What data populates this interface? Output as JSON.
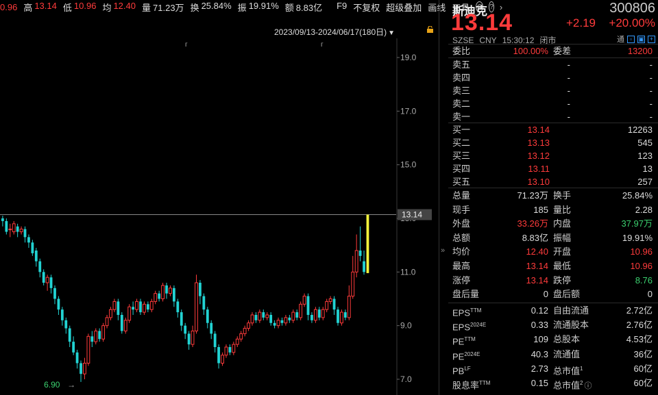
{
  "topbar": {
    "cut_value": "0.96",
    "items": [
      {
        "label": "高",
        "value": "13.14",
        "color": "red"
      },
      {
        "label": "低",
        "value": "10.96",
        "color": "red"
      },
      {
        "label": "均",
        "value": "12.40",
        "color": "red"
      },
      {
        "label": "量",
        "value": "71.23万",
        "color": "white"
      },
      {
        "label": "换",
        "value": "25.84%",
        "color": "white"
      },
      {
        "label": "振",
        "value": "19.91%",
        "color": "white"
      },
      {
        "label": "额",
        "value": "8.83亿",
        "color": "white"
      }
    ],
    "menu": [
      "F9",
      "不复权",
      "超级叠加",
      "画线",
      "工具"
    ],
    "icons": [
      "settings-icon",
      "help-icon",
      "chevron-right-icon"
    ],
    "range": "2023/09/13-2024/06/17(180日)"
  },
  "chart_data": {
    "type": "candlestick",
    "ylim": [
      7.0,
      19.0
    ],
    "yticks": [
      "19.0",
      "17.0",
      "15.0",
      "13.0",
      "11.0",
      "9.0",
      "7.0"
    ],
    "current_price_label": "13.14",
    "min_label": "6.90",
    "up_color": "#ff3b3b",
    "down_color": "#22d3d3",
    "last_color": "#f5f53b",
    "candles": [
      {
        "o": 13.0,
        "c": 12.9,
        "h": 13.1,
        "l": 12.7
      },
      {
        "o": 12.9,
        "c": 12.5,
        "h": 13.0,
        "l": 12.4
      },
      {
        "o": 12.6,
        "c": 12.6,
        "h": 12.8,
        "l": 12.3
      },
      {
        "o": 12.5,
        "c": 12.8,
        "h": 12.9,
        "l": 12.4
      },
      {
        "o": 12.7,
        "c": 12.5,
        "h": 12.8,
        "l": 12.3
      },
      {
        "o": 12.5,
        "c": 12.6,
        "h": 12.7,
        "l": 12.4
      },
      {
        "o": 12.6,
        "c": 12.3,
        "h": 12.7,
        "l": 12.1
      },
      {
        "o": 12.3,
        "c": 12.1,
        "h": 12.4,
        "l": 11.9
      },
      {
        "o": 12.1,
        "c": 11.7,
        "h": 12.2,
        "l": 11.6
      },
      {
        "o": 11.8,
        "c": 11.4,
        "h": 11.9,
        "l": 11.2
      },
      {
        "o": 11.4,
        "c": 11.0,
        "h": 11.5,
        "l": 10.8
      },
      {
        "o": 11.0,
        "c": 10.6,
        "h": 11.1,
        "l": 10.5
      },
      {
        "o": 10.6,
        "c": 10.8,
        "h": 10.9,
        "l": 10.3
      },
      {
        "o": 10.8,
        "c": 10.4,
        "h": 10.9,
        "l": 10.2
      },
      {
        "o": 10.4,
        "c": 10.0,
        "h": 10.5,
        "l": 9.8
      },
      {
        "o": 10.0,
        "c": 9.6,
        "h": 10.1,
        "l": 9.4
      },
      {
        "o": 9.6,
        "c": 9.2,
        "h": 9.7,
        "l": 9.0
      },
      {
        "o": 9.2,
        "c": 8.9,
        "h": 9.3,
        "l": 8.7
      },
      {
        "o": 8.9,
        "c": 8.4,
        "h": 9.0,
        "l": 8.2
      },
      {
        "o": 8.4,
        "c": 8.0,
        "h": 8.6,
        "l": 7.9
      },
      {
        "o": 8.0,
        "c": 7.6,
        "h": 8.1,
        "l": 7.4
      },
      {
        "o": 7.6,
        "c": 7.2,
        "h": 7.7,
        "l": 6.9
      },
      {
        "o": 7.2,
        "c": 7.6,
        "h": 7.8,
        "l": 7.0
      },
      {
        "o": 7.6,
        "c": 8.6,
        "h": 8.7,
        "l": 7.5
      },
      {
        "o": 8.6,
        "c": 8.4,
        "h": 8.8,
        "l": 8.2
      },
      {
        "o": 8.4,
        "c": 8.8,
        "h": 8.9,
        "l": 8.3
      },
      {
        "o": 8.8,
        "c": 8.5,
        "h": 8.9,
        "l": 8.4
      },
      {
        "o": 8.5,
        "c": 9.0,
        "h": 9.1,
        "l": 8.4
      },
      {
        "o": 9.0,
        "c": 9.3,
        "h": 9.4,
        "l": 8.9
      },
      {
        "o": 9.3,
        "c": 9.6,
        "h": 9.7,
        "l": 9.2
      },
      {
        "o": 9.6,
        "c": 9.9,
        "h": 10.0,
        "l": 9.5
      },
      {
        "o": 9.9,
        "c": 9.4,
        "h": 10.0,
        "l": 9.2
      },
      {
        "o": 9.4,
        "c": 8.8,
        "h": 9.5,
        "l": 8.7
      },
      {
        "o": 8.8,
        "c": 9.2,
        "h": 9.3,
        "l": 8.7
      },
      {
        "o": 9.2,
        "c": 9.7,
        "h": 9.8,
        "l": 9.1
      },
      {
        "o": 9.7,
        "c": 9.6,
        "h": 9.9,
        "l": 9.4
      },
      {
        "o": 9.6,
        "c": 9.9,
        "h": 10.0,
        "l": 9.5
      },
      {
        "o": 9.9,
        "c": 9.5,
        "h": 10.0,
        "l": 9.4
      },
      {
        "o": 9.5,
        "c": 9.8,
        "h": 9.9,
        "l": 9.4
      },
      {
        "o": 9.8,
        "c": 9.6,
        "h": 9.9,
        "l": 9.5
      },
      {
        "o": 9.6,
        "c": 9.9,
        "h": 10.0,
        "l": 9.5
      },
      {
        "o": 9.9,
        "c": 10.2,
        "h": 10.3,
        "l": 9.8
      },
      {
        "o": 10.2,
        "c": 10.0,
        "h": 10.3,
        "l": 9.9
      },
      {
        "o": 10.0,
        "c": 10.5,
        "h": 10.6,
        "l": 9.9
      },
      {
        "o": 10.5,
        "c": 10.2,
        "h": 10.6,
        "l": 10.0
      },
      {
        "o": 10.2,
        "c": 10.4,
        "h": 10.5,
        "l": 10.1
      },
      {
        "o": 10.4,
        "c": 9.9,
        "h": 10.5,
        "l": 9.7
      },
      {
        "o": 9.9,
        "c": 9.5,
        "h": 10.0,
        "l": 9.3
      },
      {
        "o": 9.5,
        "c": 9.0,
        "h": 9.6,
        "l": 8.8
      },
      {
        "o": 9.0,
        "c": 8.7,
        "h": 9.1,
        "l": 8.5
      },
      {
        "o": 8.7,
        "c": 8.3,
        "h": 8.8,
        "l": 8.1
      },
      {
        "o": 8.3,
        "c": 8.8,
        "h": 9.0,
        "l": 8.2
      },
      {
        "o": 8.8,
        "c": 10.6,
        "h": 10.9,
        "l": 8.7
      },
      {
        "o": 10.6,
        "c": 10.1,
        "h": 10.7,
        "l": 9.8
      },
      {
        "o": 10.1,
        "c": 9.6,
        "h": 10.2,
        "l": 9.4
      },
      {
        "o": 9.6,
        "c": 9.1,
        "h": 9.7,
        "l": 8.9
      },
      {
        "o": 9.1,
        "c": 8.7,
        "h": 9.2,
        "l": 8.5
      },
      {
        "o": 8.7,
        "c": 8.2,
        "h": 8.8,
        "l": 8.0
      },
      {
        "o": 8.2,
        "c": 7.6,
        "h": 8.3,
        "l": 7.4
      },
      {
        "o": 7.6,
        "c": 7.9,
        "h": 8.0,
        "l": 7.5
      },
      {
        "o": 7.9,
        "c": 8.2,
        "h": 8.3,
        "l": 7.8
      },
      {
        "o": 8.2,
        "c": 8.0,
        "h": 8.3,
        "l": 7.9
      },
      {
        "o": 8.0,
        "c": 8.3,
        "h": 8.4,
        "l": 7.9
      },
      {
        "o": 8.3,
        "c": 8.5,
        "h": 8.6,
        "l": 8.2
      },
      {
        "o": 8.5,
        "c": 8.7,
        "h": 8.8,
        "l": 8.4
      },
      {
        "o": 8.7,
        "c": 8.9,
        "h": 9.0,
        "l": 8.6
      },
      {
        "o": 8.9,
        "c": 9.1,
        "h": 9.2,
        "l": 8.8
      },
      {
        "o": 9.1,
        "c": 9.4,
        "h": 9.5,
        "l": 9.0
      },
      {
        "o": 9.4,
        "c": 9.2,
        "h": 9.5,
        "l": 9.1
      },
      {
        "o": 9.2,
        "c": 9.5,
        "h": 9.6,
        "l": 9.1
      },
      {
        "o": 9.5,
        "c": 9.3,
        "h": 9.6,
        "l": 9.2
      },
      {
        "o": 9.3,
        "c": 9.4,
        "h": 9.5,
        "l": 9.2
      },
      {
        "o": 9.4,
        "c": 9.1,
        "h": 9.5,
        "l": 9.0
      },
      {
        "o": 9.1,
        "c": 9.0,
        "h": 9.2,
        "l": 8.9
      },
      {
        "o": 9.0,
        "c": 9.2,
        "h": 9.3,
        "l": 8.9
      },
      {
        "o": 9.2,
        "c": 9.1,
        "h": 9.3,
        "l": 9.0
      },
      {
        "o": 9.1,
        "c": 9.3,
        "h": 9.4,
        "l": 9.0
      },
      {
        "o": 9.3,
        "c": 9.2,
        "h": 9.4,
        "l": 9.1
      },
      {
        "o": 9.2,
        "c": 9.5,
        "h": 9.6,
        "l": 9.1
      },
      {
        "o": 9.5,
        "c": 9.3,
        "h": 9.6,
        "l": 9.2
      },
      {
        "o": 9.3,
        "c": 9.8,
        "h": 9.9,
        "l": 9.2
      },
      {
        "o": 9.8,
        "c": 10.1,
        "h": 10.2,
        "l": 9.7
      },
      {
        "o": 10.1,
        "c": 9.4,
        "h": 10.2,
        "l": 9.2
      },
      {
        "o": 9.4,
        "c": 9.2,
        "h": 9.5,
        "l": 9.1
      },
      {
        "o": 9.2,
        "c": 9.6,
        "h": 9.7,
        "l": 9.1
      },
      {
        "o": 9.6,
        "c": 9.3,
        "h": 9.7,
        "l": 9.2
      },
      {
        "o": 9.3,
        "c": 9.6,
        "h": 9.7,
        "l": 9.2
      },
      {
        "o": 9.6,
        "c": 9.9,
        "h": 10.0,
        "l": 9.5
      },
      {
        "o": 9.9,
        "c": 10.0,
        "h": 10.1,
        "l": 9.8
      },
      {
        "o": 10.0,
        "c": 9.6,
        "h": 10.1,
        "l": 9.4
      },
      {
        "o": 9.6,
        "c": 9.1,
        "h": 9.7,
        "l": 9.0
      },
      {
        "o": 9.1,
        "c": 9.5,
        "h": 9.6,
        "l": 9.0
      },
      {
        "o": 9.5,
        "c": 9.3,
        "h": 9.6,
        "l": 9.2
      },
      {
        "o": 9.3,
        "c": 10.1,
        "h": 10.5,
        "l": 9.2
      },
      {
        "o": 10.1,
        "c": 11.0,
        "h": 11.6,
        "l": 10.0
      },
      {
        "o": 11.0,
        "c": 11.8,
        "h": 12.4,
        "l": 10.8
      },
      {
        "o": 11.8,
        "c": 11.6,
        "h": 12.7,
        "l": 11.4
      },
      {
        "o": 11.4,
        "c": 11.0,
        "h": 11.8,
        "l": 10.9
      },
      {
        "o": 10.96,
        "c": 13.14,
        "h": 13.14,
        "l": 10.96
      }
    ]
  },
  "panel": {
    "name": "斯迪克",
    "code": "300806",
    "price": "13.14",
    "change": "+2.19",
    "change_pct": "+20.00%",
    "exchange": "SZSE",
    "currency": "CNY",
    "time": "15:30:12",
    "status": "闭市",
    "tong": "通",
    "weibi": {
      "label": "委比",
      "value": "100.00%",
      "diff_label": "委差",
      "diff_value": "13200"
    },
    "asks": [
      {
        "label": "卖五",
        "price": "-",
        "vol": "-"
      },
      {
        "label": "卖四",
        "price": "-",
        "vol": "-"
      },
      {
        "label": "卖三",
        "price": "-",
        "vol": "-"
      },
      {
        "label": "卖二",
        "price": "-",
        "vol": "-"
      },
      {
        "label": "卖一",
        "price": "-",
        "vol": "-"
      }
    ],
    "bids": [
      {
        "label": "买一",
        "price": "13.14",
        "vol": "12263"
      },
      {
        "label": "买二",
        "price": "13.13",
        "vol": "545"
      },
      {
        "label": "买三",
        "price": "13.12",
        "vol": "123"
      },
      {
        "label": "买四",
        "price": "13.11",
        "vol": "13"
      },
      {
        "label": "买五",
        "price": "13.10",
        "vol": "257"
      }
    ],
    "stats": [
      {
        "l1": "总量",
        "v1": "71.23万",
        "c1": "wht",
        "l2": "换手",
        "v2": "25.84%",
        "c2": "wht"
      },
      {
        "l1": "现手",
        "v1": "185",
        "c1": "wht",
        "l2": "量比",
        "v2": "2.28",
        "c2": "wht"
      },
      {
        "l1": "外盘",
        "v1": "33.26万",
        "c1": "red",
        "l2": "内盘",
        "v2": "37.97万",
        "c2": "green"
      },
      {
        "l1": "总额",
        "v1": "8.83亿",
        "c1": "wht",
        "l2": "振幅",
        "v2": "19.91%",
        "c2": "wht"
      },
      {
        "l1": "均价",
        "v1": "12.40",
        "c1": "red",
        "l2": "开盘",
        "v2": "10.96",
        "c2": "red"
      },
      {
        "l1": "最高",
        "v1": "13.14",
        "c1": "red",
        "l2": "最低",
        "v2": "10.96",
        "c2": "red"
      },
      {
        "l1": "涨停",
        "v1": "13.14",
        "c1": "red",
        "l2": "跌停",
        "v2": "8.76",
        "c2": "green"
      },
      {
        "l1": "盘后量",
        "v1": "0",
        "c1": "wht",
        "l2": "盘后额",
        "v2": "0",
        "c2": "wht"
      }
    ],
    "fundamentals": [
      {
        "l1": "EPS",
        "s1": "TTM",
        "v1": "0.12",
        "l2": "自由流通",
        "s2": "",
        "v2": "2.72亿"
      },
      {
        "l1": "EPS",
        "s1": "2024E",
        "v1": "0.33",
        "l2": "流通股本",
        "s2": "",
        "v2": "2.76亿"
      },
      {
        "l1": "PE",
        "s1": "TTM",
        "v1": "109",
        "l2": "总股本",
        "s2": "",
        "v2": "4.53亿"
      },
      {
        "l1": "PE",
        "s1": "2024E",
        "v1": "40.3",
        "l2": "流通值",
        "s2": "",
        "v2": "36亿"
      },
      {
        "l1": "PB",
        "s1": "LF",
        "v1": "2.73",
        "l2": "总市值",
        "s2": "1",
        "v2": "60亿"
      },
      {
        "l1": "股息率",
        "s1": "TTM",
        "v1": "0.15",
        "l2": "总市值",
        "s2": "2",
        "v2": "60亿"
      }
    ]
  }
}
